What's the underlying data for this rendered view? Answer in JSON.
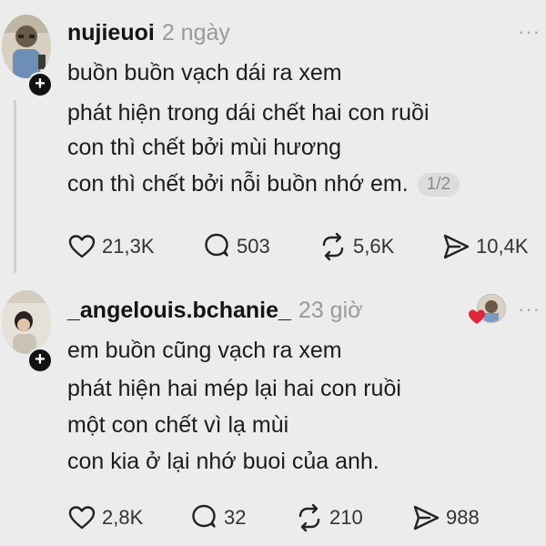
{
  "posts": [
    {
      "username": "nujieuoi",
      "time": "2 ngày",
      "lines": [
        "buồn buồn vạch dái ra xem",
        "phát hiện trong dái chết hai con ruồi",
        "con thì chết bởi mùi hương",
        "con thì chết bởi nỗi buồn nhớ em."
      ],
      "pager": "1/2",
      "likes": "21,3K",
      "comments": "503",
      "reposts": "5,6K",
      "shares": "10,4K",
      "more": "···"
    },
    {
      "username": "_angelouis.bchanie_",
      "time": "23 giờ",
      "lines": [
        "em buồn cũng vạch ra xem",
        "phát hiện hai mép lại hai con ruồi",
        "một con chết vì lạ mùi",
        "con kia ở lại nhớ buoi của anh."
      ],
      "likes": "2,8K",
      "comments": "32",
      "reposts": "210",
      "shares": "988",
      "more": "···"
    }
  ],
  "colors": {
    "background": "#ececec",
    "text": "#1c1c1c",
    "muted": "#9a9a9a",
    "heart_badge": "#e0263c"
  },
  "icons": [
    "heart-icon",
    "comment-icon",
    "repost-icon",
    "share-icon",
    "plus-icon",
    "more-icon"
  ]
}
